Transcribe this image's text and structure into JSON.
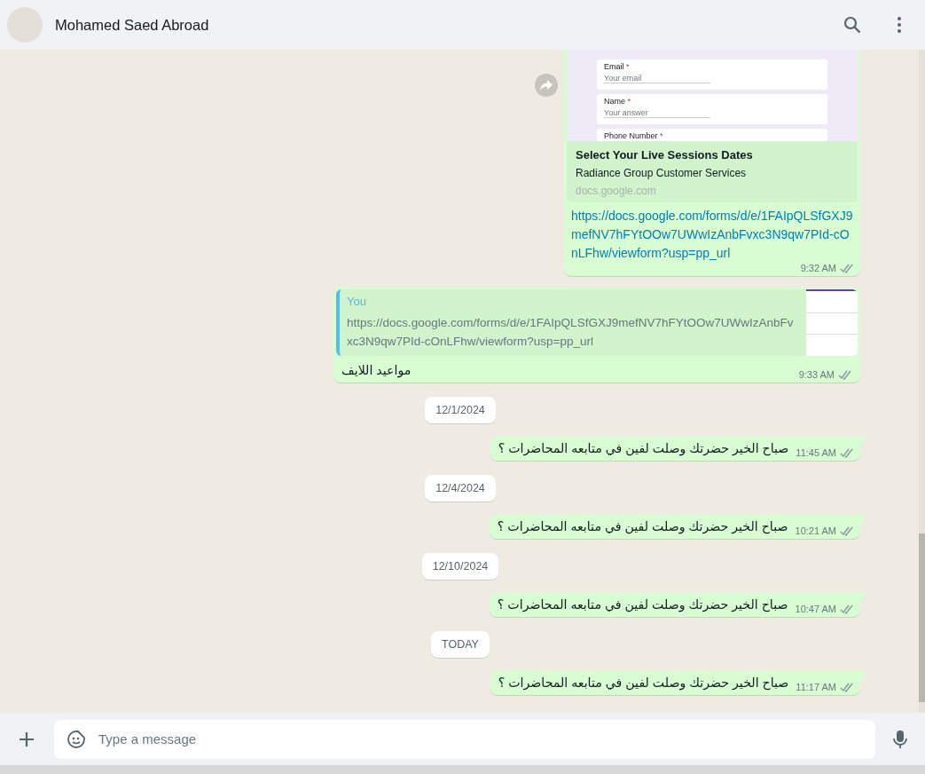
{
  "header": {
    "contact_name": "Mohamed Saed Abroad"
  },
  "messages": [
    {
      "kind": "link",
      "preview": {
        "form_fields": [
          {
            "label": "Email",
            "required_mark": "*",
            "placeholder": "Your email"
          },
          {
            "label": "Name",
            "required_mark": "*",
            "placeholder": "Your answer"
          },
          {
            "label": "Phone Number",
            "required_mark": "*"
          }
        ],
        "title": "Select Your Live Sessions Dates",
        "description": "Radiance Group Customer Services",
        "domain": "docs.google.com"
      },
      "text": "https://docs.google.com/forms/d/e/1FAIpQLSfGXJ9mefNV7hFYtOOw7UWwIzAnbFvxc3N9qw7PId-cOnLFhw/viewform?usp=pp_url",
      "time": "9:32 AM",
      "read": false
    },
    {
      "kind": "reply",
      "quote": {
        "author": "You",
        "text": "https://docs.google.com/forms/d/e/1FAIpQLSfGXJ9mefNV7hFYtOOw7UWwIzAnbFvxc3N9qw7PId-cOnLFhw/viewform?usp=pp_url"
      },
      "text": "مواعيد اللايف",
      "time": "9:33 AM",
      "read": false
    },
    {
      "kind": "date",
      "label": "12/1/2024"
    },
    {
      "kind": "text",
      "text": "صباح الخير حضرتك وصلت لفين في متابعه المحاضرات ؟",
      "time": "11:45 AM",
      "read": false
    },
    {
      "kind": "date",
      "label": "12/4/2024"
    },
    {
      "kind": "text",
      "text": "صباح الخير حضرتك وصلت لفين في متابعه المحاضرات ؟",
      "time": "10:21 AM",
      "read": false
    },
    {
      "kind": "date",
      "label": "12/10/2024"
    },
    {
      "kind": "text",
      "text": "صباح الخير حضرتك وصلت لفين في متابعه المحاضرات ؟",
      "time": "10:47 AM",
      "read": false
    },
    {
      "kind": "date",
      "label": "TODAY"
    },
    {
      "kind": "text",
      "text": "صباح الخير حضرتك وصلت لفين في متابعه المحاضرات ؟",
      "time": "11:17 AM",
      "read": false
    }
  ],
  "composer": {
    "placeholder": "Type a message"
  }
}
